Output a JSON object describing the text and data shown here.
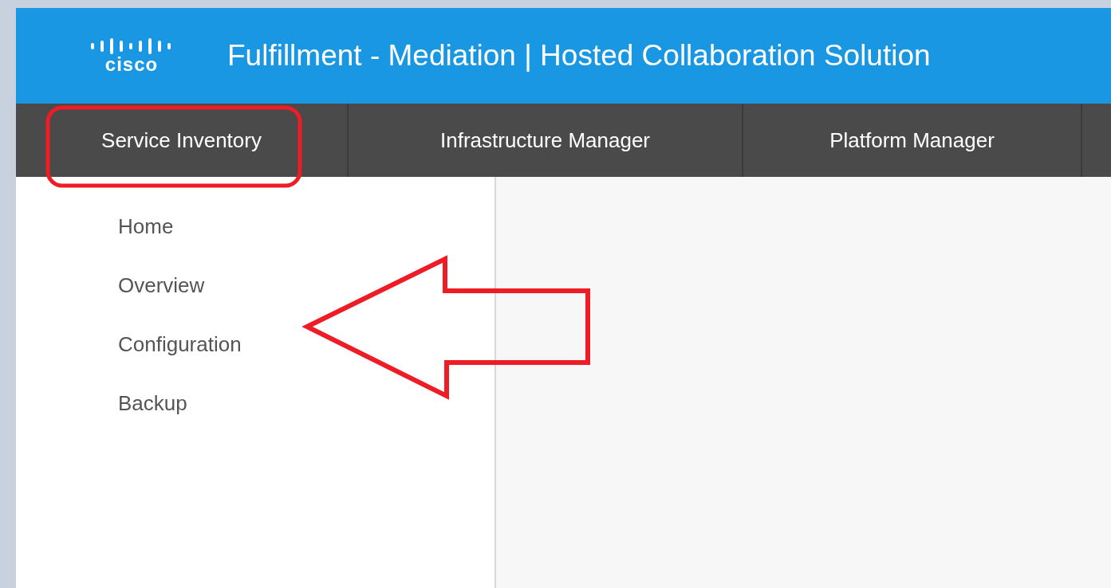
{
  "header": {
    "logo_text": "cisco",
    "title": "Fulfillment - Mediation | Hosted Collaboration Solution"
  },
  "nav_tabs": [
    {
      "label": "Service Inventory"
    },
    {
      "label": "Infrastructure Manager"
    },
    {
      "label": "Platform Manager"
    }
  ],
  "sidebar": {
    "items": [
      {
        "label": "Home"
      },
      {
        "label": "Overview"
      },
      {
        "label": "Configuration"
      },
      {
        "label": "Backup"
      }
    ]
  }
}
